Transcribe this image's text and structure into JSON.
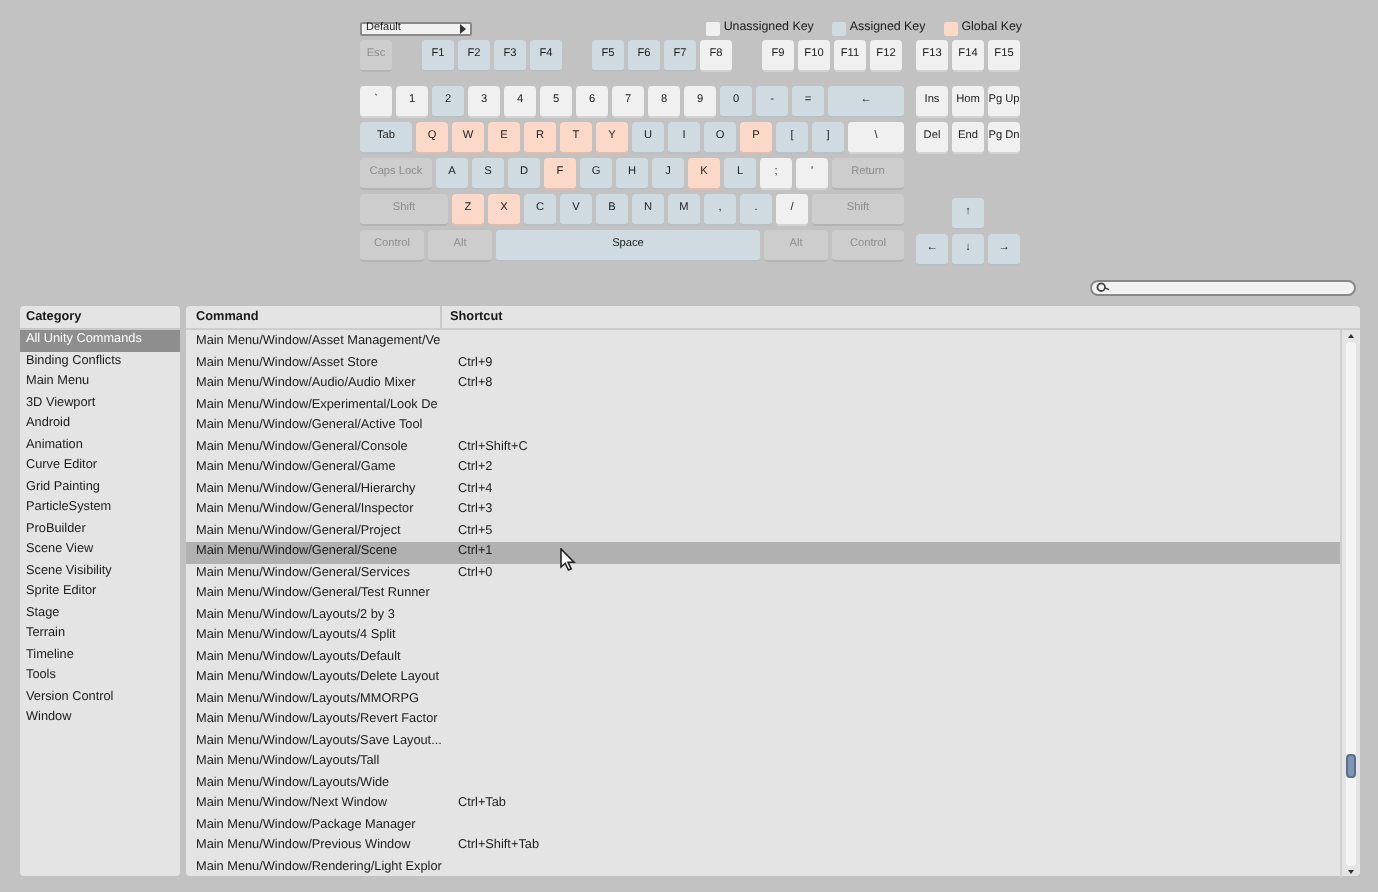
{
  "keyboard": {
    "layout_dropdown": "Default",
    "legend": [
      {
        "label": "Unassigned Key",
        "color": "#f0f0f0"
      },
      {
        "label": "Assigned Key",
        "color": "#d0dbe1"
      },
      {
        "label": "Global Key",
        "color": "#fbd8c8"
      }
    ],
    "function_keys": [
      [
        {
          "label": "Esc",
          "kind": "disabled"
        }
      ],
      [
        {
          "label": "F1",
          "kind": "assigned"
        },
        {
          "label": "F2",
          "kind": "assigned"
        },
        {
          "label": "F3",
          "kind": "assigned"
        },
        {
          "label": "F4",
          "kind": "assigned"
        }
      ],
      [
        {
          "label": "F5",
          "kind": "assigned"
        },
        {
          "label": "F6",
          "kind": "assigned"
        },
        {
          "label": "F7",
          "kind": "assigned"
        },
        {
          "label": "F8",
          "kind": "unassigned"
        }
      ],
      [
        {
          "label": "F9",
          "kind": "unassigned"
        },
        {
          "label": "F10",
          "kind": "unassigned"
        },
        {
          "label": "F11",
          "kind": "unassigned"
        },
        {
          "label": "F12",
          "kind": "unassigned"
        }
      ]
    ],
    "rows": [
      {
        "keys": [
          {
            "label": "`",
            "kind": "unassigned"
          },
          {
            "label": "1",
            "kind": "unassigned"
          },
          {
            "label": "2",
            "kind": "assigned"
          },
          {
            "label": "3",
            "kind": "unassigned"
          },
          {
            "label": "4",
            "kind": "unassigned"
          },
          {
            "label": "5",
            "kind": "unassigned"
          },
          {
            "label": "6",
            "kind": "unassigned"
          },
          {
            "label": "7",
            "kind": "unassigned"
          },
          {
            "label": "8",
            "kind": "unassigned"
          },
          {
            "label": "9",
            "kind": "unassigned"
          },
          {
            "label": "0",
            "kind": "assigned"
          },
          {
            "label": "-",
            "kind": "assigned"
          },
          {
            "label": "=",
            "kind": "assigned"
          },
          {
            "label": "←",
            "kind": "assigned"
          }
        ]
      },
      {
        "keys": [
          {
            "label": "Tab",
            "kind": "assigned"
          },
          {
            "label": "Q",
            "kind": "global"
          },
          {
            "label": "W",
            "kind": "global"
          },
          {
            "label": "E",
            "kind": "global"
          },
          {
            "label": "R",
            "kind": "global"
          },
          {
            "label": "T",
            "kind": "global"
          },
          {
            "label": "Y",
            "kind": "global"
          },
          {
            "label": "U",
            "kind": "assigned"
          },
          {
            "label": "I",
            "kind": "assigned"
          },
          {
            "label": "O",
            "kind": "assigned"
          },
          {
            "label": "P",
            "kind": "global"
          },
          {
            "label": "[",
            "kind": "assigned"
          },
          {
            "label": "]",
            "kind": "assigned"
          },
          {
            "label": "\\",
            "kind": "unassigned"
          }
        ]
      },
      {
        "keys": [
          {
            "label": "Caps Lock",
            "kind": "disabled"
          },
          {
            "label": "A",
            "kind": "assigned"
          },
          {
            "label": "S",
            "kind": "assigned"
          },
          {
            "label": "D",
            "kind": "assigned"
          },
          {
            "label": "F",
            "kind": "global"
          },
          {
            "label": "G",
            "kind": "assigned"
          },
          {
            "label": "H",
            "kind": "assigned"
          },
          {
            "label": "J",
            "kind": "assigned"
          },
          {
            "label": "K",
            "kind": "global"
          },
          {
            "label": "L",
            "kind": "assigned"
          },
          {
            "label": ";",
            "kind": "unassigned"
          },
          {
            "label": "'",
            "kind": "unassigned"
          },
          {
            "label": "Return",
            "kind": "disabled"
          }
        ]
      },
      {
        "keys": [
          {
            "label": "Shift",
            "kind": "disabled"
          },
          {
            "label": "Z",
            "kind": "global"
          },
          {
            "label": "X",
            "kind": "global"
          },
          {
            "label": "C",
            "kind": "assigned"
          },
          {
            "label": "V",
            "kind": "assigned"
          },
          {
            "label": "B",
            "kind": "assigned"
          },
          {
            "label": "N",
            "kind": "assigned"
          },
          {
            "label": "M",
            "kind": "assigned"
          },
          {
            "label": ",",
            "kind": "assigned"
          },
          {
            "label": ".",
            "kind": "assigned"
          },
          {
            "label": "/",
            "kind": "unassigned"
          },
          {
            "label": "Shift",
            "kind": "disabled"
          }
        ]
      },
      {
        "keys": [
          {
            "label": "Control",
            "kind": "disabled"
          },
          {
            "label": "Alt",
            "kind": "disabled"
          },
          {
            "label": "Space",
            "kind": "assigned"
          },
          {
            "label": "Alt",
            "kind": "disabled"
          },
          {
            "label": "Control",
            "kind": "disabled"
          }
        ]
      }
    ],
    "nav_function_keys": [
      {
        "label": "F13",
        "kind": "unassigned"
      },
      {
        "label": "F14",
        "kind": "unassigned"
      },
      {
        "label": "F15",
        "kind": "unassigned"
      }
    ],
    "nav_rows": [
      [
        {
          "label": "Ins",
          "kind": "unassigned"
        },
        {
          "label": "Hom",
          "kind": "unassigned"
        },
        {
          "label": "Pg Up",
          "kind": "unassigned"
        }
      ],
      [
        {
          "label": "Del",
          "kind": "unassigned"
        },
        {
          "label": "End",
          "kind": "unassigned"
        },
        {
          "label": "Pg Dn",
          "kind": "unassigned"
        }
      ]
    ],
    "arrow_keys": [
      [
        {
          "label": "↑",
          "kind": "assigned"
        }
      ],
      [
        {
          "label": "←",
          "kind": "assigned"
        },
        {
          "label": "↓",
          "kind": "assigned"
        },
        {
          "label": "→",
          "kind": "assigned"
        }
      ]
    ]
  },
  "categories": {
    "title": "Category",
    "items": [
      {
        "label": "All Unity Commands",
        "selected": true
      },
      {
        "label": "Binding Conflicts",
        "selected": false
      },
      {
        "label": "Main Menu",
        "selected": false
      },
      {
        "label": "3D Viewport",
        "selected": false
      },
      {
        "label": "Android",
        "selected": false
      },
      {
        "label": "Animation",
        "selected": false
      },
      {
        "label": "Curve Editor",
        "selected": false
      },
      {
        "label": "Grid Painting",
        "selected": false
      },
      {
        "label": "ParticleSystem",
        "selected": false
      },
      {
        "label": "ProBuilder",
        "selected": false
      },
      {
        "label": "Scene View",
        "selected": false
      },
      {
        "label": "Scene Visibility",
        "selected": false
      },
      {
        "label": "Sprite Editor",
        "selected": false
      },
      {
        "label": "Stage",
        "selected": false
      },
      {
        "label": "Terrain",
        "selected": false
      },
      {
        "label": "Timeline",
        "selected": false
      },
      {
        "label": "Tools",
        "selected": false
      },
      {
        "label": "Version Control",
        "selected": false
      },
      {
        "label": "Window",
        "selected": false
      }
    ]
  },
  "table": {
    "columns": [
      "Command",
      "Shortcut"
    ],
    "rows": [
      {
        "command": "Main Menu/Window/Asset Management/Ve",
        "selected": false
      },
      {
        "command": "Main Menu/Window/Asset Store",
        "shortcut": "Ctrl+9",
        "selected": false
      },
      {
        "command": "Main Menu/Window/Audio/Audio Mixer",
        "shortcut": "Ctrl+8",
        "selected": false
      },
      {
        "command": "Main Menu/Window/Experimental/Look De",
        "selected": false
      },
      {
        "command": "Main Menu/Window/General/Active Tool",
        "selected": false
      },
      {
        "command": "Main Menu/Window/General/Console",
        "shortcut": "Ctrl+Shift+C",
        "selected": false
      },
      {
        "command": "Main Menu/Window/General/Game",
        "shortcut": "Ctrl+2",
        "selected": false
      },
      {
        "command": "Main Menu/Window/General/Hierarchy",
        "shortcut": "Ctrl+4",
        "selected": false
      },
      {
        "command": "Main Menu/Window/General/Inspector",
        "shortcut": "Ctrl+3",
        "selected": false
      },
      {
        "command": "Main Menu/Window/General/Project",
        "shortcut": "Ctrl+5",
        "selected": false
      },
      {
        "command": "Main Menu/Window/General/Scene",
        "shortcut": "Ctrl+1",
        "selected": true
      },
      {
        "command": "Main Menu/Window/General/Services",
        "shortcut": "Ctrl+0",
        "selected": false
      },
      {
        "command": "Main Menu/Window/General/Test Runner",
        "selected": false
      },
      {
        "command": "Main Menu/Window/Layouts/2 by 3",
        "selected": false
      },
      {
        "command": "Main Menu/Window/Layouts/4 Split",
        "selected": false
      },
      {
        "command": "Main Menu/Window/Layouts/Default",
        "selected": false
      },
      {
        "command": "Main Menu/Window/Layouts/Delete Layout",
        "selected": false
      },
      {
        "command": "Main Menu/Window/Layouts/MMORPG",
        "selected": false
      },
      {
        "command": "Main Menu/Window/Layouts/Revert Factor",
        "selected": false
      },
      {
        "command": "Main Menu/Window/Layouts/Save Layout...",
        "selected": false
      },
      {
        "command": "Main Menu/Window/Layouts/Tall",
        "selected": false
      },
      {
        "command": "Main Menu/Window/Layouts/Wide",
        "selected": false
      },
      {
        "command": "Main Menu/Window/Next Window",
        "shortcut": "Ctrl+Tab",
        "selected": false
      },
      {
        "command": "Main Menu/Window/Package Manager",
        "selected": false
      },
      {
        "command": "Main Menu/Window/Previous Window",
        "shortcut": "Ctrl+Shift+Tab",
        "selected": false
      },
      {
        "command": "Main Menu/Window/Rendering/Light Explor",
        "selected": false
      }
    ]
  }
}
